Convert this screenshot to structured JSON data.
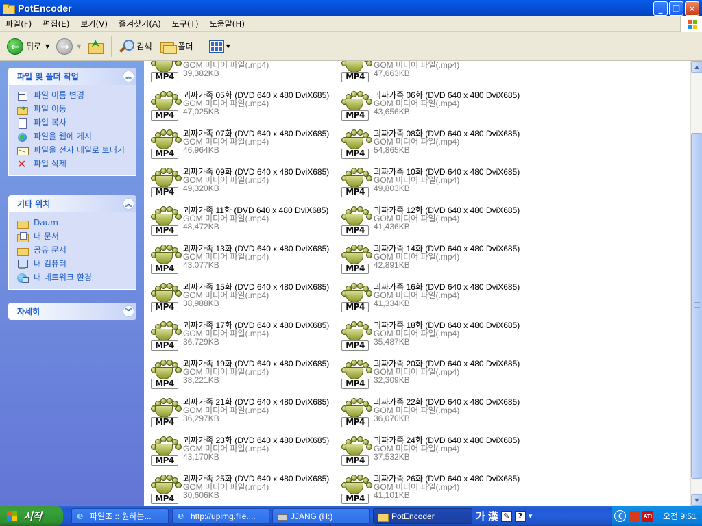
{
  "window": {
    "title": "PotEncoder",
    "controls": {
      "minimize": "_",
      "maximize": "❐",
      "close": "✕"
    }
  },
  "menu": [
    "파일(F)",
    "편집(E)",
    "보기(V)",
    "즐겨찾기(A)",
    "도구(T)",
    "도움말(H)"
  ],
  "toolbar": {
    "back": "뒤로",
    "search": "검색",
    "folders": "폴더"
  },
  "taskpane": {
    "file_tasks": {
      "title": "파일 및 폴더 작업",
      "items": [
        "파일 이름 변경",
        "파일 이동",
        "파일 복사",
        "파일을 웹에 게시",
        "파일을 전자 메일로 보내기",
        "파일 삭제"
      ]
    },
    "other_places": {
      "title": "기타 위치",
      "items": [
        "Daum",
        "내 문서",
        "공유 문서",
        "내 컴퓨터",
        "내 네트워크 환경"
      ]
    },
    "details": {
      "title": "자세히"
    }
  },
  "files": {
    "icon_label": "MP4",
    "type_label": "GOM 미디어 파일(.mp4)",
    "items": [
      {
        "name": "",
        "size": "39,382KB"
      },
      {
        "name": "",
        "size": "47,663KB"
      },
      {
        "name": "괴짜가족 05화 (DVD 640 x 480 DviX685)",
        "size": "47,025KB"
      },
      {
        "name": "괴짜가족 06화 (DVD 640 x 480 DviX685)",
        "size": "43,656KB"
      },
      {
        "name": "괴짜가족 07화 (DVD 640 x 480 DviX685)",
        "size": "46,964KB"
      },
      {
        "name": "괴짜가족 08화 (DVD 640 x 480 DviX685)",
        "size": "54,865KB"
      },
      {
        "name": "괴짜가족 09화 (DVD 640 x 480 DviX685)",
        "size": "49,320KB"
      },
      {
        "name": "괴짜가족 10화 (DVD 640 x 480 DviX685)",
        "size": "49,803KB"
      },
      {
        "name": "괴짜가족 11화 (DVD 640 x 480 DviX685)",
        "size": "48,472KB"
      },
      {
        "name": "괴짜가족 12화 (DVD 640 x 480 DviX685)",
        "size": "41,436KB"
      },
      {
        "name": "괴짜가족 13화 (DVD 640 x 480 DviX685)",
        "size": "43,077KB"
      },
      {
        "name": "괴짜가족 14화 (DVD 640 x 480 DviX685)",
        "size": "42,891KB"
      },
      {
        "name": "괴짜가족 15화 (DVD 640 x 480 DviX685)",
        "size": "38,988KB"
      },
      {
        "name": "괴짜가족 16화 (DVD 640 x 480 DviX685)",
        "size": "41,334KB"
      },
      {
        "name": "괴짜가족 17화 (DVD 640 x 480 DviX685)",
        "size": "36,729KB"
      },
      {
        "name": "괴짜가족 18화 (DVD 640 x 480 DviX685)",
        "size": "35,487KB"
      },
      {
        "name": "괴짜가족 19화 (DVD 640 x 480 DviX685)",
        "size": "38,221KB"
      },
      {
        "name": "괴짜가족 20화 (DVD 640 x 480 DviX685)",
        "size": "32,309KB"
      },
      {
        "name": "괴짜가족 21화 (DVD 640 x 480 DviX685)",
        "size": "36,297KB"
      },
      {
        "name": "괴짜가족 22화 (DVD 640 x 480 DviX685)",
        "size": "36,070KB"
      },
      {
        "name": "괴짜가족 23화 (DVD 640 x 480 DviX685)",
        "size": "43,170KB"
      },
      {
        "name": "괴짜가족 24화 (DVD 640 x 480 DviX685)",
        "size": "37,532KB"
      },
      {
        "name": "괴짜가족 25화 (DVD 640 x 480 DviX685)",
        "size": "30,606KB"
      },
      {
        "name": "괴짜가족 26화 (DVD 640 x 480 DviX685)",
        "size": "41,101KB"
      }
    ]
  },
  "taskbar": {
    "start": "시작",
    "buttons": [
      "파일조 :: 원하는...",
      "http://upimg.file....",
      "JJANG (H:)",
      "PotEncoder"
    ],
    "ime": {
      "lang": "가",
      "hanja": "漢",
      "help": "?"
    },
    "tray": {
      "ati": "ATI",
      "clock": "오전 9:51"
    }
  },
  "colors": {
    "taskbar": "#245edc",
    "start": "#36a236",
    "link": "#215dc6",
    "pane": "#7ba2e7"
  }
}
